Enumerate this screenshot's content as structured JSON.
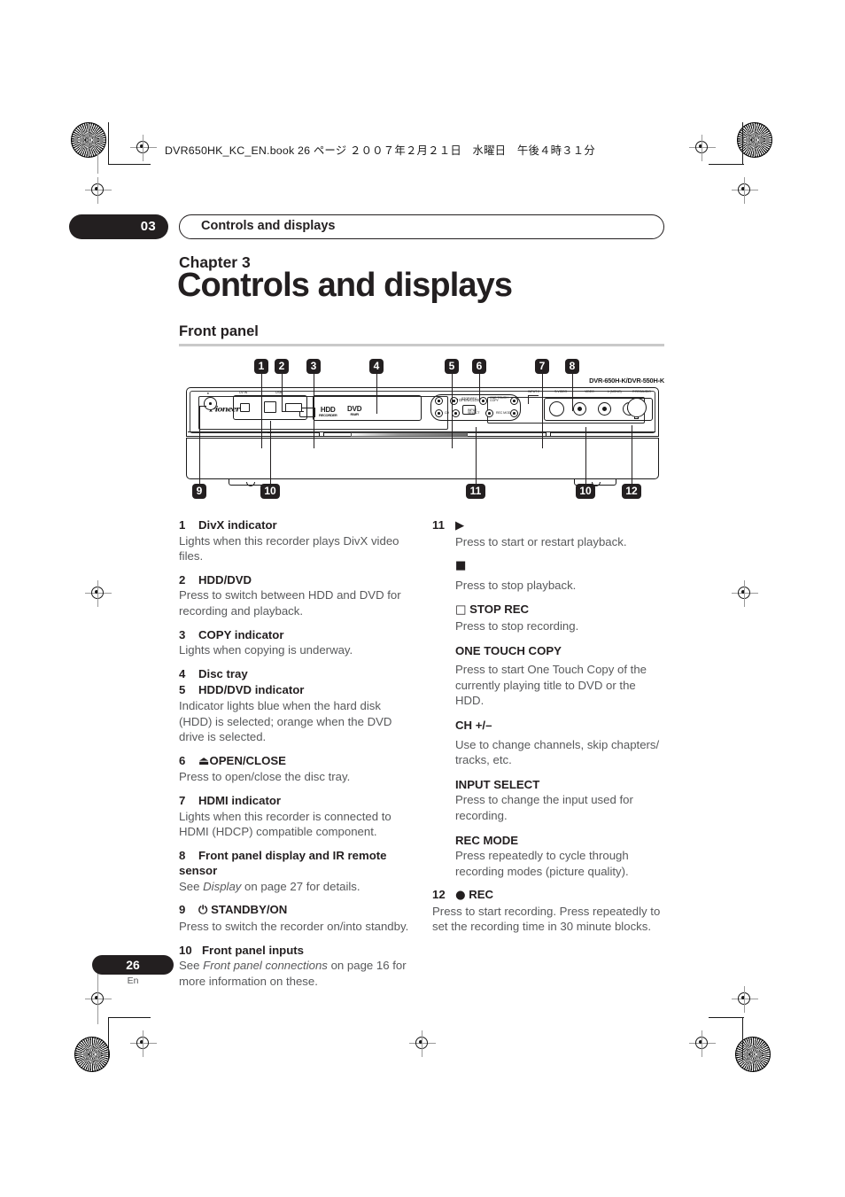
{
  "print_marks": {
    "book_header": "DVR650HK_KC_EN.book  26 ページ  ２００７年２月２１日　水曜日　午後４時３１分"
  },
  "running_head": {
    "chapter_number": "03",
    "title": "Controls and displays"
  },
  "titles": {
    "chapter_label": "Chapter 3",
    "chapter_title": "Controls and displays",
    "section_heading": "Front panel"
  },
  "figure": {
    "model_number": "DVR-650H-K/DVR-550H-K",
    "brand": "Pioneer",
    "callouts": [
      "1",
      "2",
      "3",
      "4",
      "5",
      "6",
      "7",
      "8",
      "9",
      "10",
      "11",
      "10",
      "12"
    ],
    "panel_labels": {
      "open_close": "OPEN/CLOSE",
      "hdd_logo": "HDD",
      "hdd_logo_sub": "RECORDER",
      "dvd_logo": "DVD",
      "dvd_logo_sub": "RW/R",
      "dv_in": "DV IN",
      "usb": "USB",
      "input2": "INPUT 2",
      "s_video": "S-VIDEO",
      "video": "VIDEO",
      "audio_l": "L (MONO)",
      "audio_r": "R",
      "audio": "AUDIO",
      "rec": "REC",
      "stop_rec": "STOP REC",
      "one_touch_copy": "ONE TOUCH COPY",
      "ch": "CH",
      "input_select": "INPUT SELECT",
      "rec_mode": "REC MODE"
    }
  },
  "left_column": [
    {
      "num": "1",
      "title": "DivX indicator",
      "body": "Lights when this recorder plays DivX video files."
    },
    {
      "num": "2",
      "title": "HDD/DVD",
      "body": "Press to switch between HDD and DVD for recording and playback."
    },
    {
      "num": "3",
      "title": "COPY indicator",
      "body": "Lights when copying is underway."
    },
    {
      "num": "4",
      "title": "Disc tray",
      "body": ""
    },
    {
      "num": "5",
      "title": "HDD/DVD indicator",
      "body": "Indicator lights blue when the hard disk (HDD) is selected; orange when the DVD drive is selected."
    },
    {
      "num": "6",
      "glyph": "⏏",
      "title": "OPEN/CLOSE",
      "body": "Press to open/close the disc tray."
    },
    {
      "num": "7",
      "title": "HDMI indicator",
      "body": "Lights when this recorder is connected to HDMI (HDCP) compatible component."
    },
    {
      "num": "8",
      "title": "Front panel display and IR remote sensor",
      "body_pre": "See ",
      "body_em": "Display",
      "body_post": " on page 27 for details."
    },
    {
      "num": "9",
      "glyph": "⏻",
      "title": "STANDBY/ON",
      "body": "Press to switch the recorder on/into standby."
    },
    {
      "num": "10",
      "title": "Front panel inputs",
      "body_pre": "See ",
      "body_em": "Front panel connections",
      "body_post": " on page 16 for more information on these."
    }
  ],
  "right_column": {
    "num": "11",
    "play_glyph": "▶",
    "play_body": "Press to start or restart playback.",
    "stop_glyph": "■",
    "stop_body": "Press to stop playback.",
    "stoprec_glyph": "□",
    "stoprec_title": "STOP REC",
    "stoprec_body": "Press to stop recording.",
    "otc_title": "ONE TOUCH COPY",
    "otc_body": "Press to start One Touch Copy of the currently playing title to DVD or the HDD.",
    "ch_title": "CH +/–",
    "ch_body": "Use to change channels, skip chapters/ tracks, etc.",
    "input_title": "INPUT SELECT",
    "input_body": "Press to change the input used for recording.",
    "recmode_title": "REC MODE",
    "recmode_body": "Press repeatedly to cycle through recording modes (picture quality).",
    "rec_num": "12",
    "rec_glyph": "●",
    "rec_title": "REC",
    "rec_body": "Press to start recording. Press repeatedly to set the recording time in 30 minute blocks."
  },
  "footer": {
    "page_number": "26",
    "language": "En"
  },
  "colors": {
    "ink": "#231f20",
    "body_gray": "#58595b",
    "rule_gray": "#c9c9c9"
  }
}
